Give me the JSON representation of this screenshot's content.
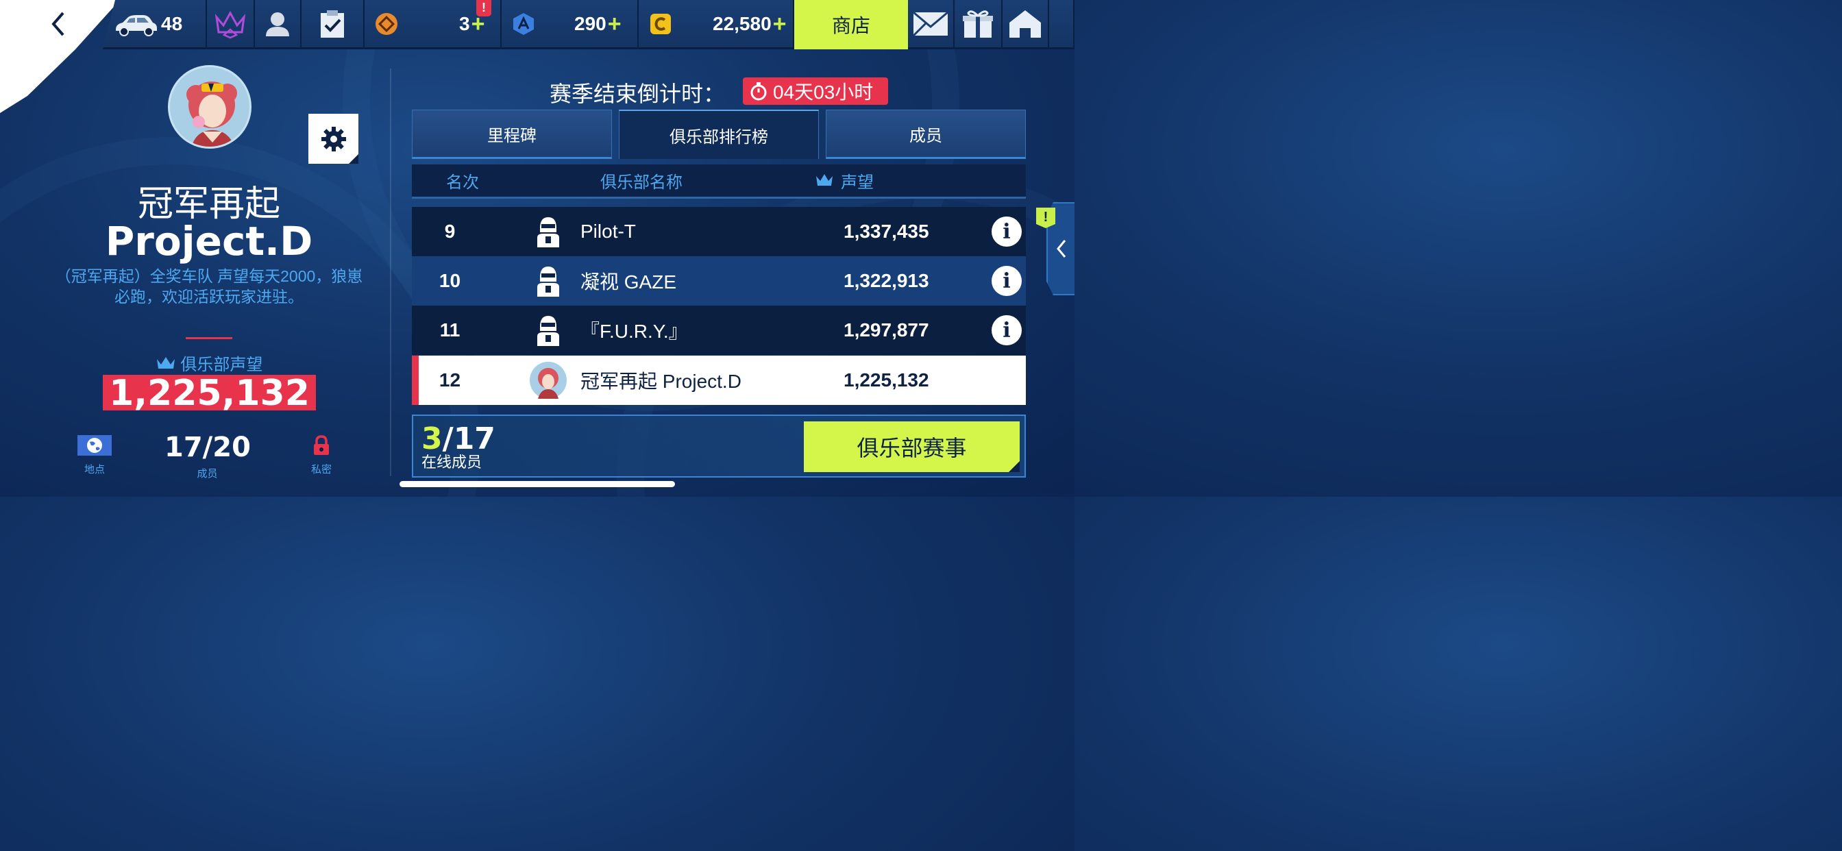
{
  "topbar": {
    "cars_count": "48",
    "ticket_count": "3",
    "alert_mark": "!",
    "blue_currency": "290",
    "gold_currency": "22,580",
    "plus": "+",
    "shop_label": "商店"
  },
  "club": {
    "name_cn": "冠军再起",
    "name_en": "Project.D",
    "description": "（冠军再起）全奖车队  声望每天2000，狼崽必跑，欢迎活跃玩家进驻。",
    "prestige_label": "俱乐部声望",
    "prestige_value": "1,225,132",
    "members_value": "17/20",
    "location_label": "地点",
    "members_label": "成员",
    "privacy_label": "私密"
  },
  "season": {
    "countdown_label": "赛季结束倒计时：",
    "countdown_value": "04天03小时"
  },
  "tabs": [
    {
      "label": "里程碑"
    },
    {
      "label": "俱乐部排行榜"
    },
    {
      "label": "成员"
    }
  ],
  "table": {
    "headers": {
      "rank": "名次",
      "name": "俱乐部名称",
      "prestige": "声望"
    },
    "rows": [
      {
        "rank": "9",
        "name": "Pilot-T",
        "score": "1,337,435"
      },
      {
        "rank": "10",
        "name": "凝视 GAZE",
        "score": "1,322,913"
      },
      {
        "rank": "11",
        "name": "『F.U.R.Y.』",
        "score": "1,297,877"
      },
      {
        "rank": "12",
        "name": "冠军再起 Project.D",
        "score": "1,225,132"
      }
    ]
  },
  "bottom": {
    "online_current": "3",
    "online_total": "/17",
    "online_label": "在线成员",
    "event_label": "俱乐部赛事"
  },
  "side": {
    "alert_mark": "!"
  },
  "colors": {
    "accent_lime": "#d4f54a",
    "accent_red": "#e8334d",
    "accent_blue": "#4ea8ef",
    "bg_navy": "#123366"
  }
}
